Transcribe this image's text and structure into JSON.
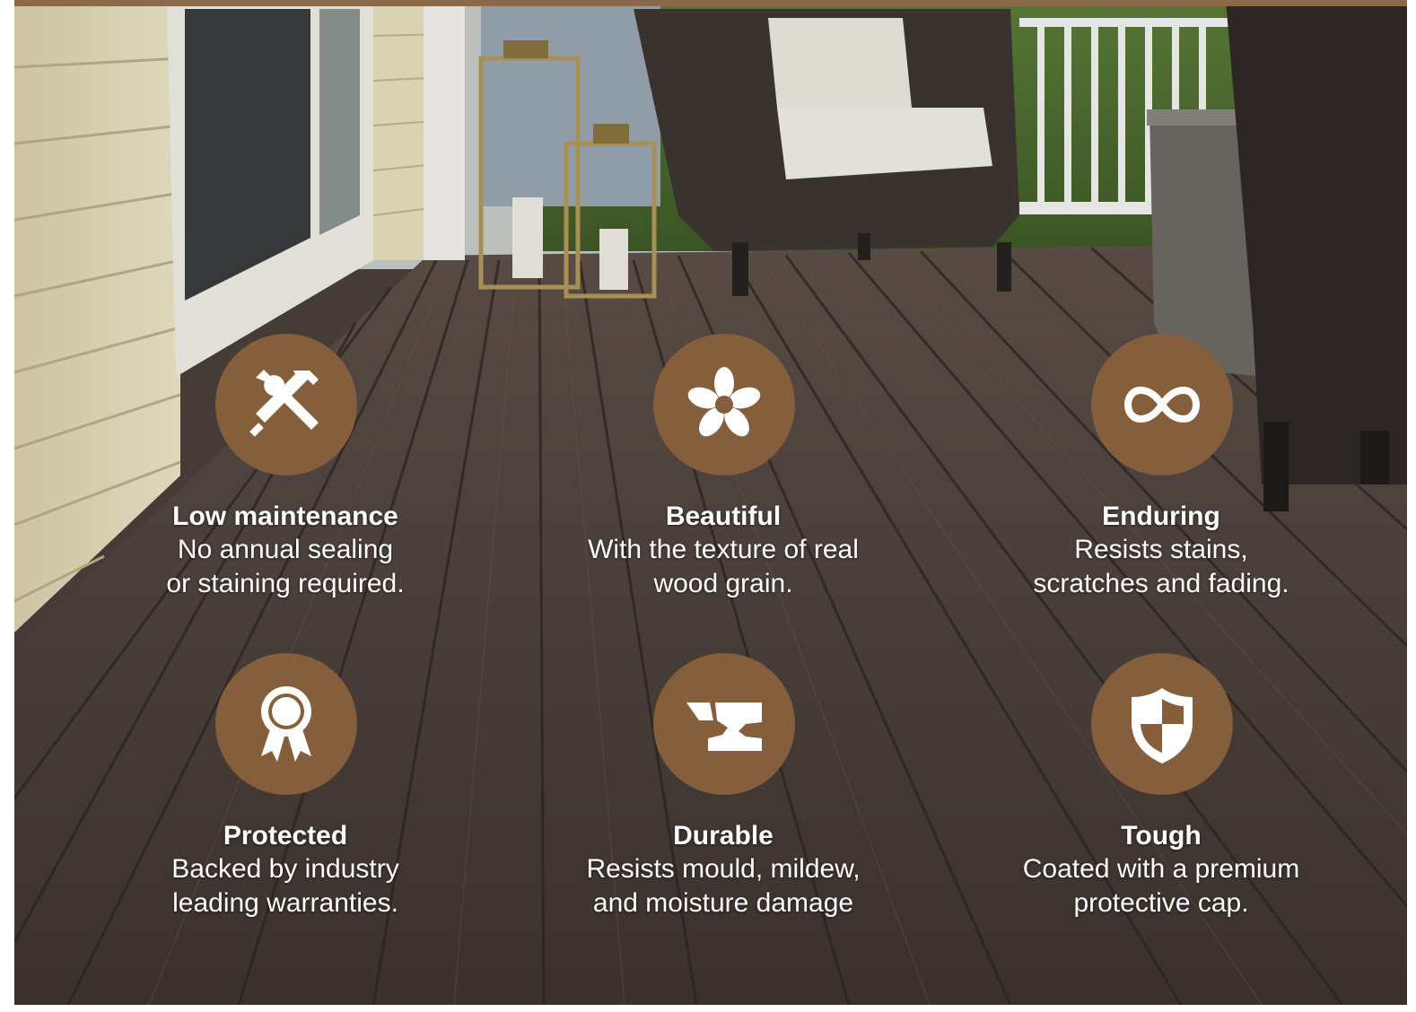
{
  "colors": {
    "accent_brown": "#855e3b",
    "top_bar": "#8a6a48",
    "deck_dark": "#4a403b",
    "siding": "#e6dfbe"
  },
  "features": [
    {
      "icon": "tools-icon",
      "title": "Low maintenance",
      "desc": "No annual sealing\nor staining required."
    },
    {
      "icon": "flower-icon",
      "title": "Beautiful",
      "desc": "With the texture of real\nwood grain."
    },
    {
      "icon": "infinity-icon",
      "title": "Enduring",
      "desc": "Resists stains,\nscratches and fading."
    },
    {
      "icon": "award-ribbon-icon",
      "title": "Protected",
      "desc": "Backed by industry\nleading warranties."
    },
    {
      "icon": "anvil-icon",
      "title": "Durable",
      "desc": "Resists mould, mildew,\nand moisture damage"
    },
    {
      "icon": "shield-icon",
      "title": "Tough",
      "desc": "Coated with a premium\nprotective cap."
    }
  ]
}
